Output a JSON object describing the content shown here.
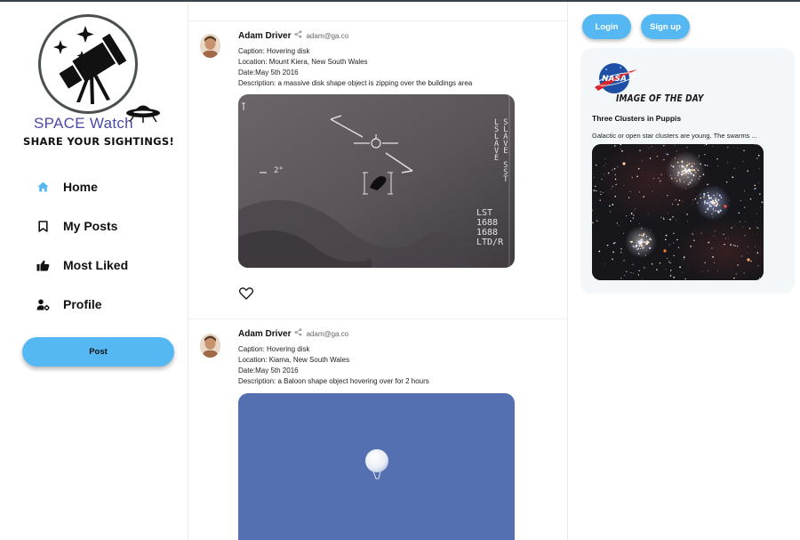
{
  "app": {
    "logo_title": "SPACE Watch",
    "logo_tagline": "SHARE YOUR SIGHTINGS!",
    "accent_color": "#56b8f3"
  },
  "sidebar": {
    "items": [
      {
        "label": "Home",
        "icon": "home-icon",
        "active": true
      },
      {
        "label": "My Posts",
        "icon": "bookmark-icon",
        "active": false
      },
      {
        "label": "Most Liked",
        "icon": "thumbs-up-icon",
        "active": false
      },
      {
        "label": "Profile",
        "icon": "user-settings-icon",
        "active": false
      }
    ],
    "post_button": "Post"
  },
  "feed": {
    "posts": [
      {
        "author": "Adam Driver",
        "email": "adam@ga.co",
        "caption": "Caption: Hovering disk",
        "location": "Location: Mount Kiera, New South Wales",
        "date": "Date:May 5th 2016",
        "description": "Description: a massive disk shape object is zipping over the buildings area",
        "image_hud": {
          "angle": "2°",
          "side_text": "L S\nS L\nL A\nA V\nV E\nE\n  S\n  S\n  T",
          "readout": "LST\n1688\n1688\nLTD/R"
        }
      },
      {
        "author": "Adam Driver",
        "email": "adam@ga.co",
        "caption": "Caption: Hovering disk",
        "location": "Location: Kiama, New South Wales",
        "date": "Date:May 5th 2016",
        "description": "Description: a Baloon shape object hovering over for 2 hours"
      }
    ]
  },
  "auth": {
    "login_label": "Login",
    "signup_label": "Sign up"
  },
  "image_of_the_day": {
    "logo_text": "NASA",
    "heading": "IMAGE OF THE DAY",
    "title": "Three Clusters in Puppis",
    "description": "Galactic or open star clusters are young. The swarms ..."
  }
}
